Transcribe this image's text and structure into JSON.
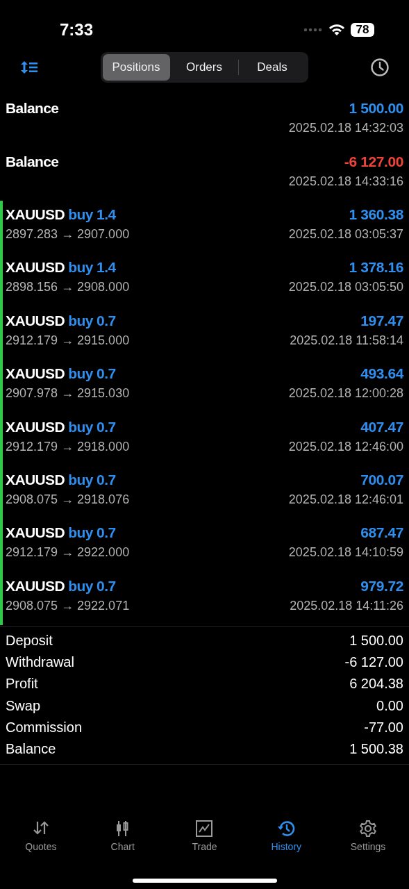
{
  "status_bar": {
    "time": "7:33",
    "battery": "78"
  },
  "segments": [
    {
      "label": "Positions",
      "selected": true
    },
    {
      "label": "Orders",
      "selected": false
    },
    {
      "label": "Deals",
      "selected": false
    }
  ],
  "rows": [
    {
      "kind": "balance",
      "title": "Balance",
      "amount": "1 500.00",
      "color": "#2f8ff0",
      "time": "2025.02.18 14:32:03"
    },
    {
      "kind": "balance",
      "title": "Balance",
      "amount": "-6 127.00",
      "color": "#f0443a",
      "time": "2025.02.18 14:33:16"
    },
    {
      "kind": "trade",
      "symbol": "XAUUSD",
      "side": "buy 1.4",
      "prices": "2897.283 → 2907.000",
      "amount": "1 360.38",
      "color": "#2f8ff0",
      "time": "2025.02.18 03:05:37"
    },
    {
      "kind": "trade",
      "symbol": "XAUUSD",
      "side": "buy 1.4",
      "prices": "2898.156 → 2908.000",
      "amount": "1 378.16",
      "color": "#2f8ff0",
      "time": "2025.02.18 03:05:50"
    },
    {
      "kind": "trade",
      "symbol": "XAUUSD",
      "side": "buy 0.7",
      "prices": "2912.179 → 2915.000",
      "amount": "197.47",
      "color": "#2f8ff0",
      "time": "2025.02.18 11:58:14"
    },
    {
      "kind": "trade",
      "symbol": "XAUUSD",
      "side": "buy 0.7",
      "prices": "2907.978 → 2915.030",
      "amount": "493.64",
      "color": "#2f8ff0",
      "time": "2025.02.18 12:00:28"
    },
    {
      "kind": "trade",
      "symbol": "XAUUSD",
      "side": "buy 0.7",
      "prices": "2912.179 → 2918.000",
      "amount": "407.47",
      "color": "#2f8ff0",
      "time": "2025.02.18 12:46:00"
    },
    {
      "kind": "trade",
      "symbol": "XAUUSD",
      "side": "buy 0.7",
      "prices": "2908.075 → 2918.076",
      "amount": "700.07",
      "color": "#2f8ff0",
      "time": "2025.02.18 12:46:01"
    },
    {
      "kind": "trade",
      "symbol": "XAUUSD",
      "side": "buy 0.7",
      "prices": "2912.179 → 2922.000",
      "amount": "687.47",
      "color": "#2f8ff0",
      "time": "2025.02.18 14:10:59"
    },
    {
      "kind": "trade",
      "symbol": "XAUUSD",
      "side": "buy 0.7",
      "prices": "2908.075 → 2922.071",
      "amount": "979.72",
      "color": "#2f8ff0",
      "time": "2025.02.18 14:11:26"
    }
  ],
  "summary": [
    {
      "label": "Deposit",
      "value": "1 500.00"
    },
    {
      "label": "Withdrawal",
      "value": "-6 127.00"
    },
    {
      "label": "Profit",
      "value": "6 204.38"
    },
    {
      "label": "Swap",
      "value": "0.00"
    },
    {
      "label": "Commission",
      "value": "-77.00"
    },
    {
      "label": "Balance",
      "value": "1 500.38"
    }
  ],
  "tab_bar": [
    {
      "kind": "quotes",
      "label": "Quotes",
      "selected": false
    },
    {
      "kind": "chart",
      "label": "Chart",
      "selected": false
    },
    {
      "kind": "trade",
      "label": "Trade",
      "selected": false
    },
    {
      "kind": "history",
      "label": "History",
      "selected": true
    },
    {
      "kind": "settings",
      "label": "Settings",
      "selected": false
    }
  ]
}
